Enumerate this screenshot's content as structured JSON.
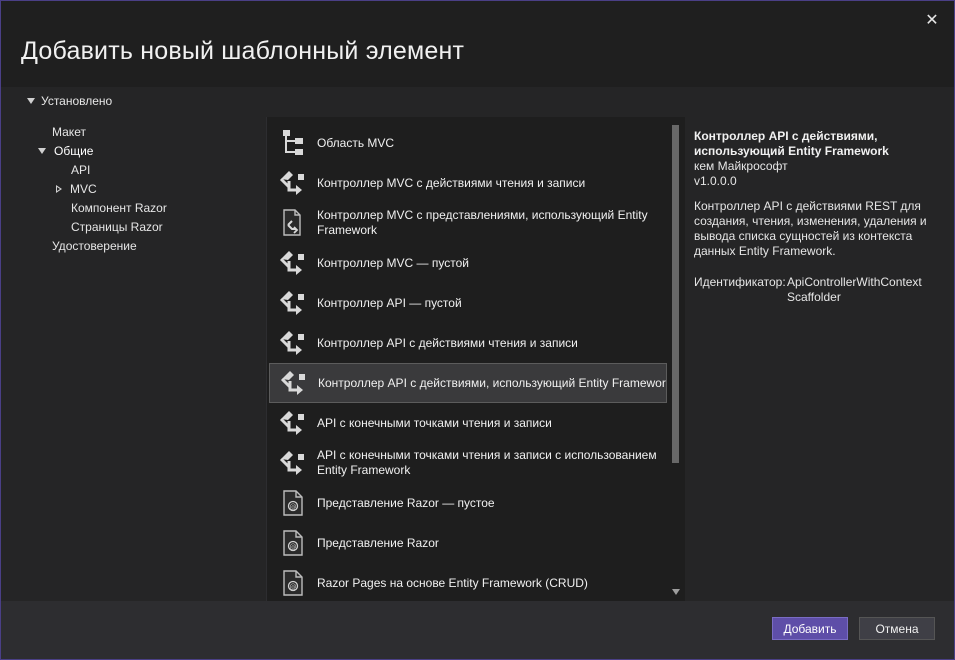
{
  "dialog": {
    "title": "Добавить новый шаблонный элемент",
    "close_glyph": "✕"
  },
  "tree": {
    "root_label": "Установлено",
    "items": [
      {
        "label": "Макет",
        "level": 1,
        "expander": "none"
      },
      {
        "label": "Общие",
        "level": 1,
        "expander": "expanded",
        "selected": true
      },
      {
        "label": "API",
        "level": 2,
        "expander": "none"
      },
      {
        "label": "MVC",
        "level": 2,
        "expander": "collapsed"
      },
      {
        "label": "Компонент Razor",
        "level": 2,
        "expander": "none"
      },
      {
        "label": "Страницы Razor",
        "level": 2,
        "expander": "none"
      },
      {
        "label": "Удостоверение",
        "level": 1,
        "expander": "none"
      }
    ]
  },
  "templates": {
    "items": [
      {
        "label": "Область MVC",
        "icon": "folder-tree-icon"
      },
      {
        "label": "Контроллер MVC с действиями чтения и записи",
        "icon": "controller-icon"
      },
      {
        "label": "Контроллер MVC с представлениями, использующий Entity Framework",
        "icon": "controller-views-icon"
      },
      {
        "label": "Контроллер MVC — пустой",
        "icon": "controller-icon"
      },
      {
        "label": "Контроллер API — пустой",
        "icon": "controller-icon"
      },
      {
        "label": "Контроллер API с действиями чтения и записи",
        "icon": "controller-icon"
      },
      {
        "label": "Контроллер API с действиями, использующий Entity Framework",
        "icon": "controller-icon",
        "selected": true
      },
      {
        "label": "API с конечными точками чтения и записи",
        "icon": "controller-icon"
      },
      {
        "label": "API с конечными точками чтения и записи с использованием Entity Framework",
        "icon": "controller-icon"
      },
      {
        "label": "Представление Razor — пустое",
        "icon": "razor-file-icon"
      },
      {
        "label": "Представление Razor",
        "icon": "razor-file-icon"
      },
      {
        "label": "Razor Pages на основе Entity Framework (CRUD)",
        "icon": "razor-file-icon"
      }
    ]
  },
  "details": {
    "title": "Контроллер API с действиями, использующий Entity Framework",
    "author": "кем Майкрософт",
    "version": "v1.0.0.0",
    "description": "Контроллер API с действиями REST для создания, чтения, изменения, удаления и вывода списка сущностей из контекста данных Entity Framework.",
    "id_label": "Идентификатор:",
    "id_value": "ApiControllerWithContext Scaffolder"
  },
  "footer": {
    "add_label": "Добавить",
    "cancel_label": "Отмена"
  },
  "colors": {
    "accent": "#5e4ea8",
    "border": "#4a3f86"
  }
}
